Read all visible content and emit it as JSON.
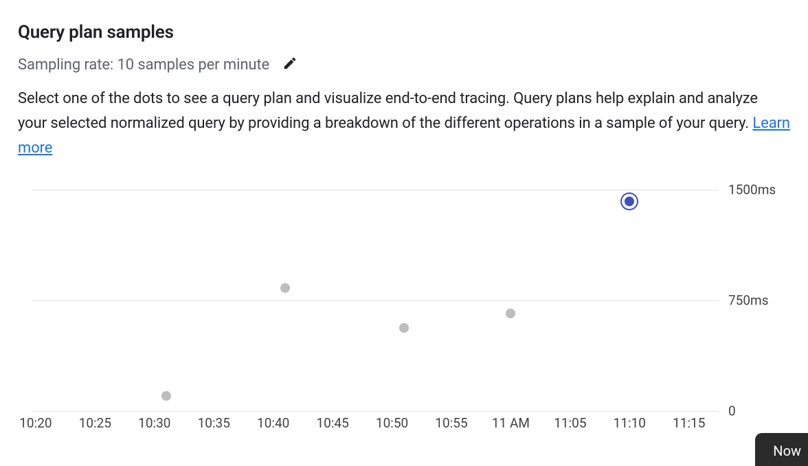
{
  "title": "Query plan samples",
  "sampling_text": "Sampling rate: 10 samples per minute",
  "description": "Select one of the dots to see a query plan and visualize end-to-end tracing. Query plans help explain and analyze your selected normalized query by providing a breakdown of the different operations in a sample of your query. ",
  "learn_more": "Learn more",
  "now_button": "Now",
  "chart_data": {
    "type": "scatter",
    "xlabel": "",
    "ylabel": "",
    "ylim": [
      0,
      1500
    ],
    "y_ticks": [
      {
        "value": 1500,
        "label": "1500ms"
      },
      {
        "value": 750,
        "label": "750ms"
      },
      {
        "value": 0,
        "label": "0"
      }
    ],
    "x_range_minutes": [
      18.5,
      77.5
    ],
    "x_ticks": [
      {
        "minute": 20,
        "label": "10:20"
      },
      {
        "minute": 25,
        "label": "10:25"
      },
      {
        "minute": 30,
        "label": "10:30"
      },
      {
        "minute": 35,
        "label": "10:35"
      },
      {
        "minute": 40,
        "label": "10:40"
      },
      {
        "minute": 45,
        "label": "10:45"
      },
      {
        "minute": 50,
        "label": "10:50"
      },
      {
        "minute": 55,
        "label": "10:55"
      },
      {
        "minute": 60,
        "label": "11 AM"
      },
      {
        "minute": 65,
        "label": "11:05"
      },
      {
        "minute": 70,
        "label": "11:10"
      },
      {
        "minute": 75,
        "label": "11:15"
      }
    ],
    "points": [
      {
        "x_minute": 31,
        "y_ms": 100,
        "selected": false
      },
      {
        "x_minute": 41,
        "y_ms": 830,
        "selected": false
      },
      {
        "x_minute": 51,
        "y_ms": 560,
        "selected": false
      },
      {
        "x_minute": 60,
        "y_ms": 660,
        "selected": false
      },
      {
        "x_minute": 70,
        "y_ms": 1420,
        "selected": true
      }
    ]
  }
}
